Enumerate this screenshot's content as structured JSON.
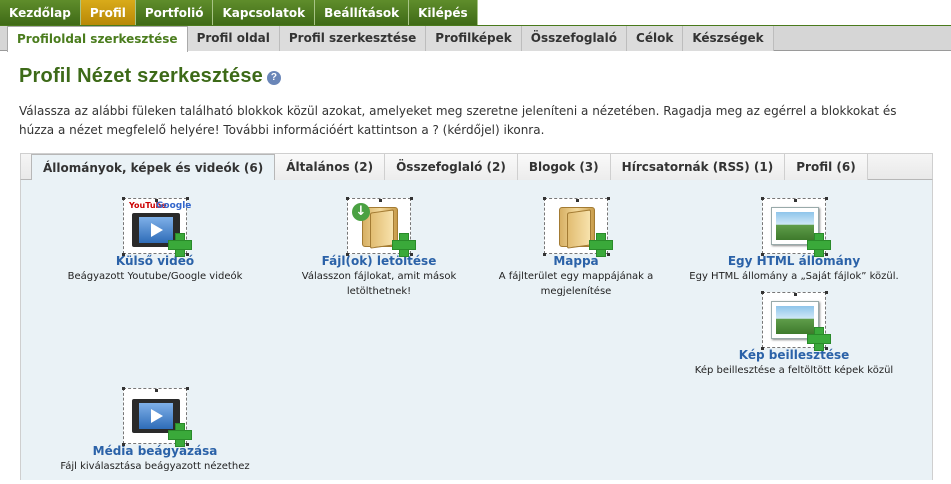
{
  "main_nav": [
    "Kezdőlap",
    "Profil",
    "Portfolió",
    "Kapcsolatok",
    "Beállítások",
    "Kilépés"
  ],
  "main_nav_active": "Profil",
  "sub_nav": [
    "Profiloldal szerkesztése",
    "Profil oldal",
    "Profil szerkesztése",
    "Profilképek",
    "Összefoglaló",
    "Célok",
    "Készségek"
  ],
  "sub_nav_active": "Profiloldal szerkesztése",
  "page": {
    "title": "Profil Nézet szerkesztése",
    "help_glyph": "?",
    "intro": "Válassza az alábbi füleken található blokkok közül azokat, amelyeket meg szeretne jeleníteni a nézetében. Ragadja meg az egérrel a blokkokat és húzza a nézet megfelelő helyére! További információért kattintson a ? (kérdőjel) ikonra."
  },
  "block_tabs": [
    "Állományok, képek és videók (6)",
    "Általános (2)",
    "Összefoglaló (2)",
    "Blogok (3)",
    "Hírcsatornák (RSS) (1)",
    "Profil (6)"
  ],
  "block_tabs_active": "Állományok, képek és videók (6)",
  "blocks": {
    "external_video": {
      "title": "Külső videó",
      "desc": "Beágyazott Youtube/Google videók",
      "badge_yt": "YouTube",
      "badge_g": "Google",
      "icon": "video-icon"
    },
    "file_download": {
      "title": "Fájl(ok) letöltése",
      "desc": "Válasszon fájlokat, amit mások letölthetnek!",
      "icon": "download-folder-icon"
    },
    "folder": {
      "title": "Mappa",
      "desc": "A fájlterület egy mappájának a megjelenítése",
      "icon": "folder-icon"
    },
    "html_file": {
      "title": "Egy HTML állomány",
      "desc": "Egy HTML állomány a „Saját fájlok” közül.",
      "icon": "picture-icon"
    },
    "image": {
      "title": "Kép beillesztése",
      "desc": "Kép beillesztése a feltöltött képek közül",
      "icon": "picture-icon"
    },
    "media": {
      "title": "Média beágyazása",
      "desc": "Fájl kiválasztása beágyazott nézethez",
      "icon": "video-icon"
    }
  },
  "colors": {
    "nav_green": "#4a7a1c",
    "nav_active": "#c9980f",
    "title_green": "#3d6a18",
    "link_blue": "#2b62a8",
    "panel_bg": "#eaf2f6"
  }
}
